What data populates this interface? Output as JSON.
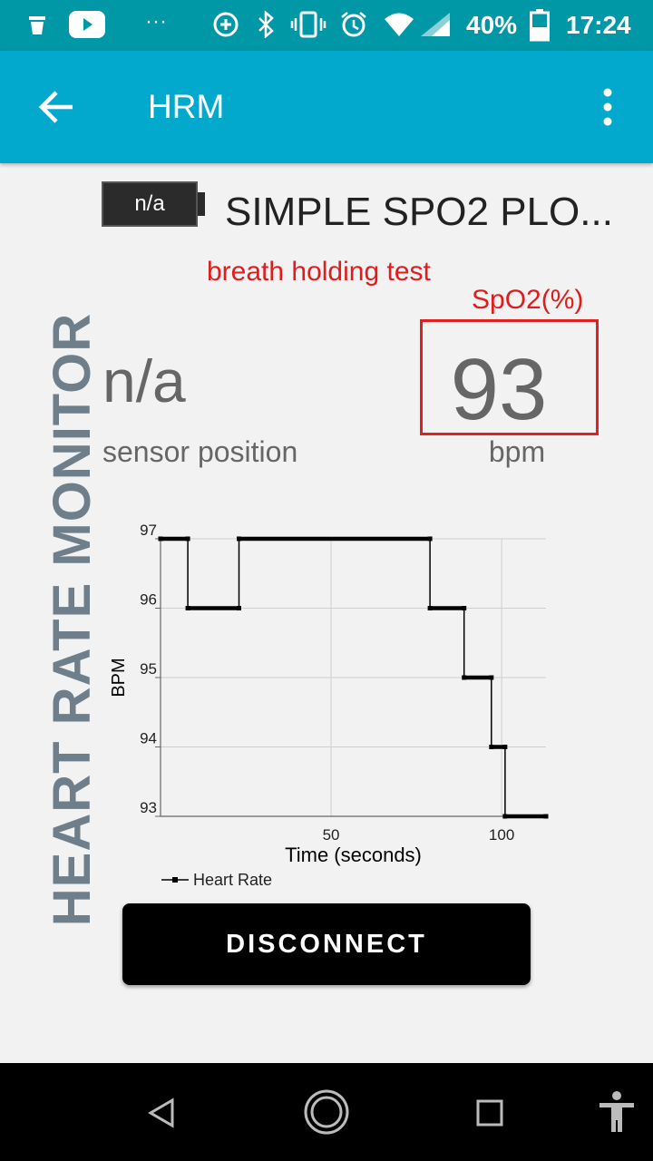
{
  "status_bar": {
    "battery_percent": "40%",
    "time": "17:24",
    "overflow": "···",
    "icons": [
      "broom-icon",
      "youtube-icon",
      "data-saver-icon",
      "bluetooth-icon",
      "vibrate-icon",
      "alarm-icon",
      "wifi-icon",
      "signal-icon",
      "battery-icon"
    ]
  },
  "app_bar": {
    "title": "HRM",
    "icons": [
      "back-arrow-icon",
      "more-vert-icon"
    ]
  },
  "sidebar_text": "HEART RATE MONITOR",
  "device": {
    "battery_label": "n/a",
    "name": "SIMPLE SPO2 PLO..."
  },
  "annotations": {
    "note": "breath holding test",
    "spo2_label": "SpO2(%)",
    "highlight_color": "#e02020"
  },
  "sensor": {
    "value": "n/a",
    "label": "sensor position"
  },
  "heart_rate": {
    "value": "93",
    "unit": "bpm"
  },
  "chart_data": {
    "type": "line",
    "title": "",
    "xlabel": "Time (seconds)",
    "ylabel": "BPM",
    "xlim": [
      0,
      113
    ],
    "ylim": [
      93,
      97
    ],
    "x_ticks": [
      50,
      100
    ],
    "y_ticks": [
      93,
      94,
      95,
      96,
      97
    ],
    "grid": true,
    "legend_placement": "bottom-left",
    "series": [
      {
        "name": "Heart Rate",
        "color": "#000000",
        "points": [
          [
            0,
            97
          ],
          [
            8,
            97
          ],
          [
            8,
            96
          ],
          [
            23,
            96
          ],
          [
            23,
            97
          ],
          [
            79,
            97
          ],
          [
            79,
            96
          ],
          [
            89,
            96
          ],
          [
            89,
            95
          ],
          [
            97,
            95
          ],
          [
            97,
            94
          ],
          [
            101,
            94
          ],
          [
            101,
            93
          ],
          [
            113,
            93
          ]
        ]
      }
    ]
  },
  "button": {
    "label": "DISCONNECT"
  },
  "nav_bar": {
    "icons": [
      "back-triangle-icon",
      "home-circle-icon",
      "recents-square-icon",
      "accessibility-icon"
    ]
  }
}
